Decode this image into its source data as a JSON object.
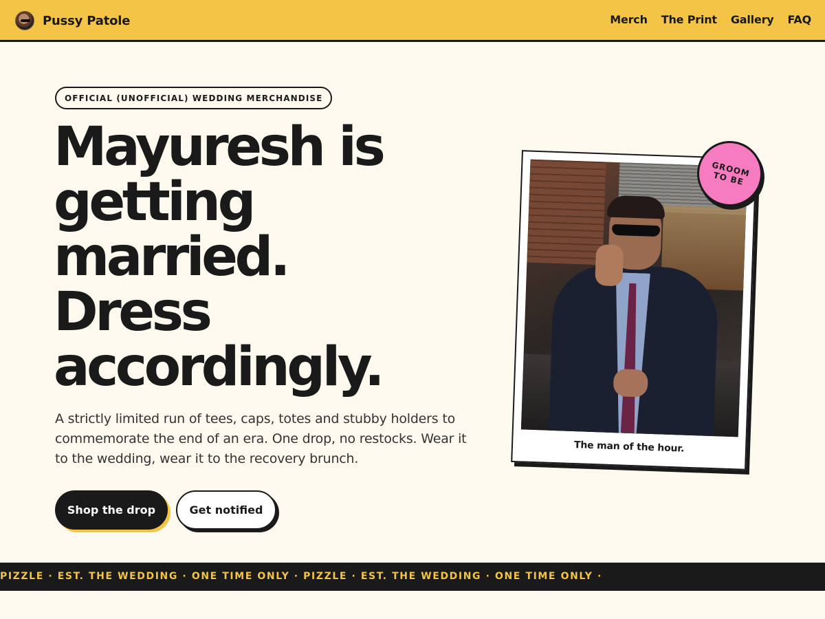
{
  "header": {
    "brand": "Pussy Patole",
    "nav": [
      "Merch",
      "The Print",
      "Gallery",
      "FAQ"
    ]
  },
  "hero": {
    "eyebrow": "OFFICIAL (UNOFFICIAL) WEDDING MERCHANDISE",
    "headline": [
      "Mayuresh is",
      "getting",
      "married.",
      "Dress",
      "accordingly."
    ],
    "lede": "A strictly limited run of tees, caps, totes and stubby holders to commemorate the end of an era. One drop, no restocks. Wear it to the wedding, wear it to the recovery brunch.",
    "primary_cta": "Shop the drop",
    "secondary_cta": "Get notified"
  },
  "polaroid": {
    "caption": "The man of the hour.",
    "sticker": [
      "GROOM",
      "TO BE"
    ]
  },
  "ticker": {
    "text": "PIZZLE · EST. THE WEDDING · ONE TIME ONLY · PIZZLE · EST. THE WEDDING · ONE TIME ONLY ·"
  },
  "colors": {
    "brand_yellow": "#f4c447",
    "ink": "#1a1a1a",
    "sticker_pink": "#f77bc0",
    "background": "#fdf9ee"
  }
}
